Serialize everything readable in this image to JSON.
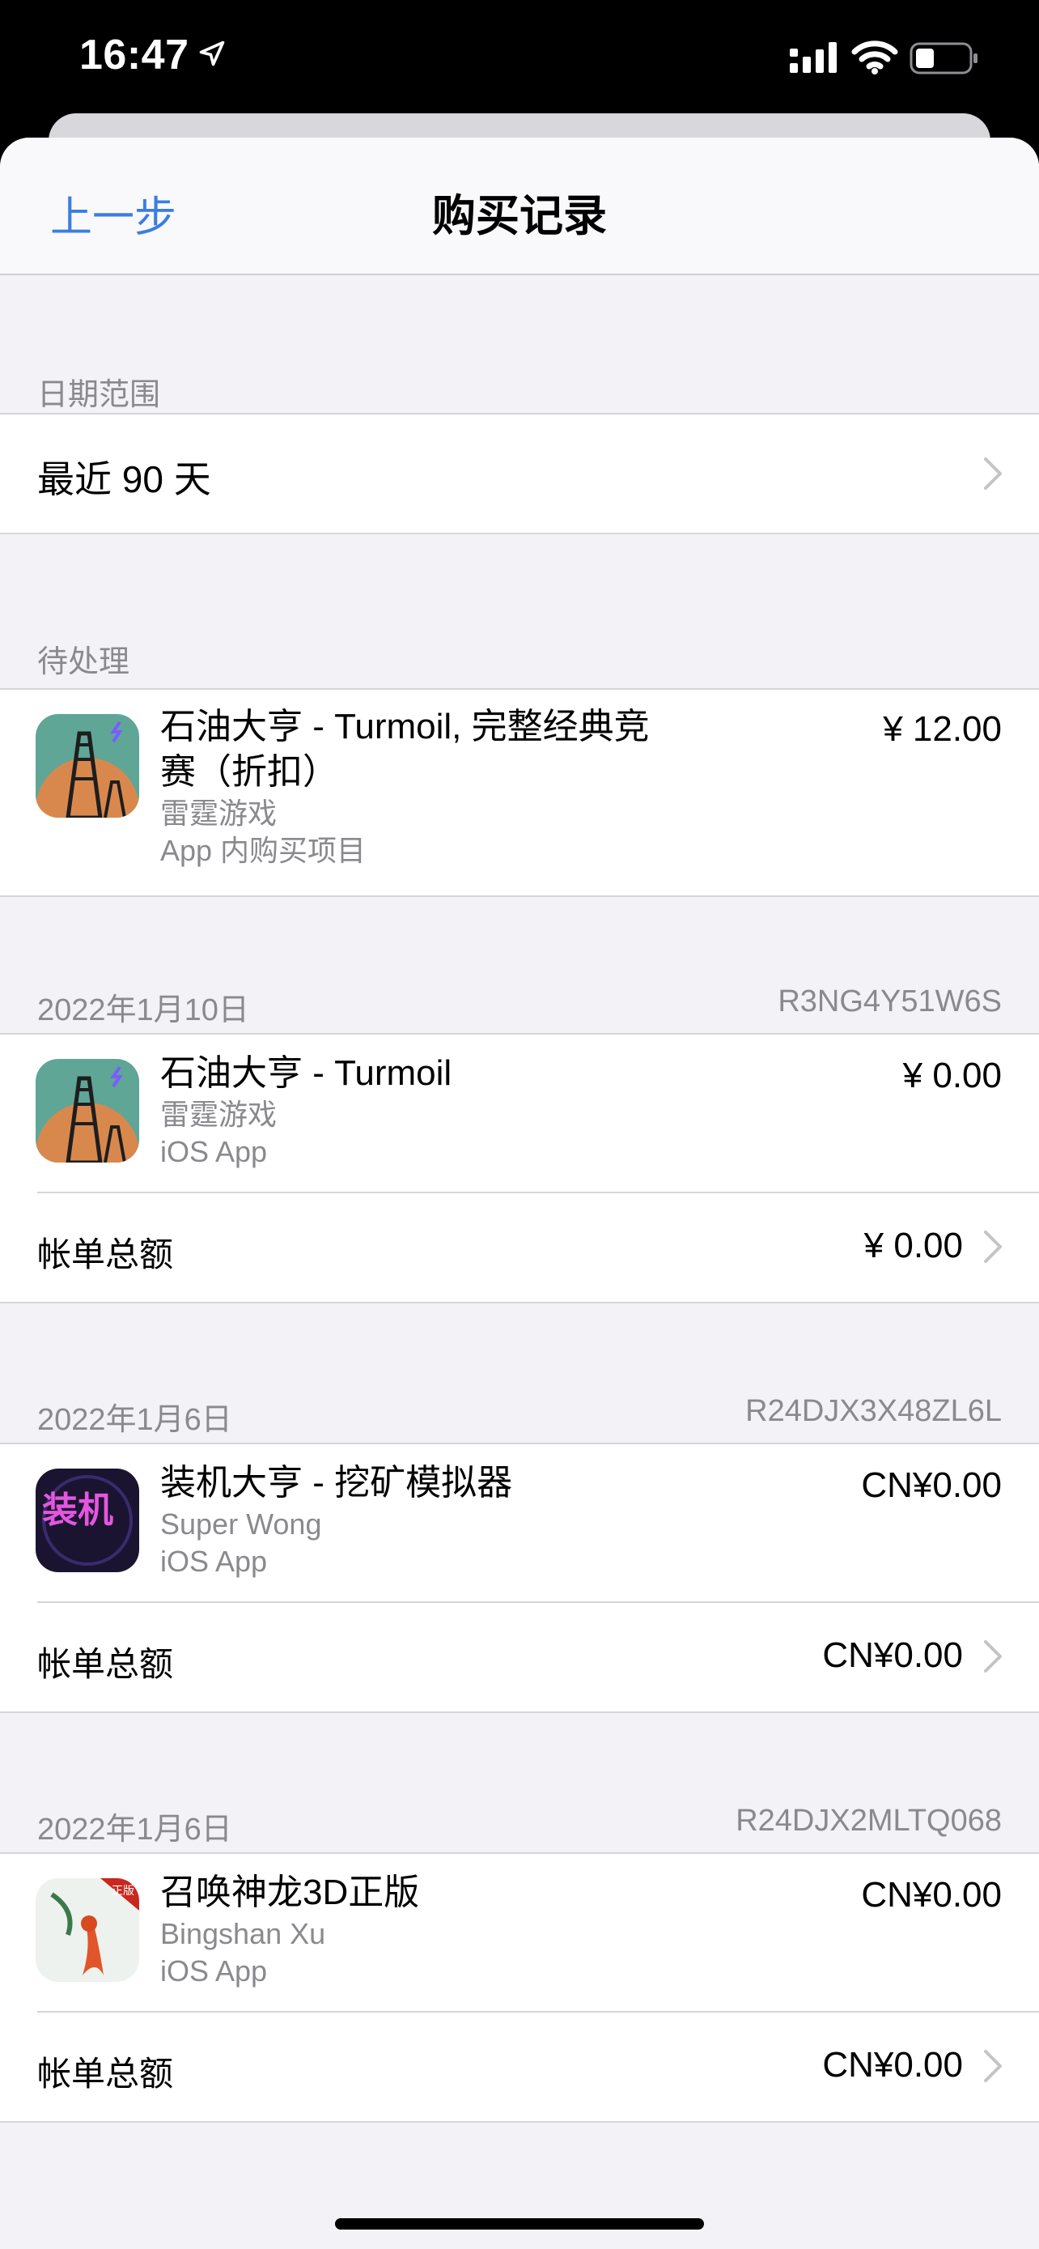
{
  "status_bar": {
    "time": "16:47"
  },
  "nav": {
    "back_label": "上一步",
    "title": "购买记录"
  },
  "date_range": {
    "header": "日期范围",
    "value": "最近 90 天"
  },
  "pending": {
    "header": "待处理",
    "item": {
      "name_line1": "石油大亨 - Turmoil, 完整经典竞",
      "name_line2": "赛（折扣）",
      "developer": "雷霆游戏",
      "kind": "App 内购买项目",
      "price": "¥ 12.00"
    }
  },
  "orders": [
    {
      "date": "2022年1月10日",
      "order_id": "R3NG4Y51W6S",
      "item": {
        "name": "石油大亨 - Turmoil",
        "developer": "雷霆游戏",
        "kind": "iOS App",
        "price": "¥ 0.00"
      },
      "total_label": "帐单总额",
      "total": "¥ 0.00"
    },
    {
      "date": "2022年1月6日",
      "order_id": "R24DJX3X48ZL6L",
      "item": {
        "name": "装机大亨 - 挖矿模拟器",
        "developer": "Super Wong",
        "kind": "iOS App",
        "price": "CN¥0.00",
        "icon_text": "装机"
      },
      "total_label": "帐单总额",
      "total": "CN¥0.00"
    },
    {
      "date": "2022年1月6日",
      "order_id": "R24DJX2MLTQ068",
      "item": {
        "name": "召唤神龙3D正版",
        "developer": "Bingshan Xu",
        "kind": "iOS App",
        "price": "CN¥0.00",
        "icon_badge": "正版"
      },
      "total_label": "帐单总额",
      "total": "CN¥0.00"
    }
  ],
  "colors": {
    "accent": "#3b7ee0",
    "background": "#f2f2f7",
    "secondary_text": "#8a8a8e"
  }
}
